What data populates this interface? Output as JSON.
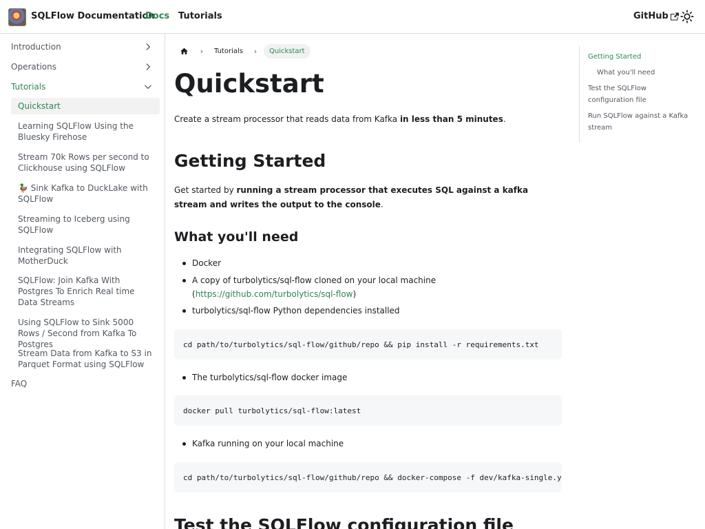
{
  "navbar": {
    "brand": "SQLFlow Documentation",
    "docs_label": "Docs",
    "tutorials_label": "Tutorials",
    "github_label": "GitHub",
    "accent_color": "#2e8555"
  },
  "sidebar": {
    "categories": [
      {
        "label": "Introduction",
        "icon": "chevron-right-icon"
      },
      {
        "label": "Operations",
        "icon": "chevron-right-icon"
      },
      {
        "label": "Tutorials",
        "icon": "chevron-down-icon"
      }
    ],
    "items": [
      {
        "label": "Quickstart"
      },
      {
        "label": "Learning SQLFlow Using the Bluesky Firehose"
      },
      {
        "label": "Stream 70k Rows per second to Clickhouse using SQLFlow"
      },
      {
        "label": "🦆 Sink Kafka to DuckLake with SQLFlow"
      },
      {
        "label": "Streaming to Iceberg using SQLFlow"
      },
      {
        "label": "Integrating SQLFlow with MotherDuck"
      },
      {
        "label": "SQLFlow: Join Kafka With Postgres To Enrich Real time Data Streams"
      },
      {
        "label": "Using SQLFlow to Sink 5000 Rows / Second from Kafka To Postgres"
      },
      {
        "label": "Stream Data from Kafka to S3 in Parquet Format using SQLFlow"
      }
    ],
    "faq_label": "FAQ"
  },
  "breadcrumb": {
    "home_icon": "home-icon",
    "items": [
      "Tutorials",
      "Quickstart"
    ]
  },
  "main": {
    "title": "Quickstart",
    "intro_prefix": "Create a stream processor that reads data from Kafka ",
    "intro_bold": "in less than 5 minutes",
    "intro_suffix": ".",
    "getting_started_heading": "Getting Started",
    "getting_started_prefix": "Get started by ",
    "getting_started_bold": "running a stream processor that executes SQL against a kafka stream and writes the output to the console",
    "getting_started_suffix": ".",
    "what_you_need_heading": "What you'll need",
    "needs": [
      "Docker",
      "A copy of turbolytics/sql-flow cloned on your local machine",
      "turbolytics/sql-flow Python dependencies installed"
    ],
    "repo_link_open": "(",
    "repo_link": "https://github.com/turbolytics/sql-flow",
    "repo_link_close": ")",
    "code1": "cd path/to/turbolytics/sql-flow/github/repo && pip install -r requirements.txt",
    "need_docker_image": "The turbolytics/sql-flow docker image",
    "code2": "docker pull turbolytics/sql-flow:latest",
    "need_kafka": "Kafka running on your local machine",
    "code3": "cd path/to/turbolytics/sql-flow/github/repo && docker-compose -f dev/kafka-single.yml up -d",
    "next_heading": "Test the SQLFlow configuration file"
  },
  "toc": {
    "items": [
      {
        "label": "Getting Started"
      },
      {
        "label": "What you'll need"
      },
      {
        "label": "Test the SQLFlow configuration file"
      },
      {
        "label": "Run SQLFlow against a Kafka stream"
      }
    ]
  }
}
